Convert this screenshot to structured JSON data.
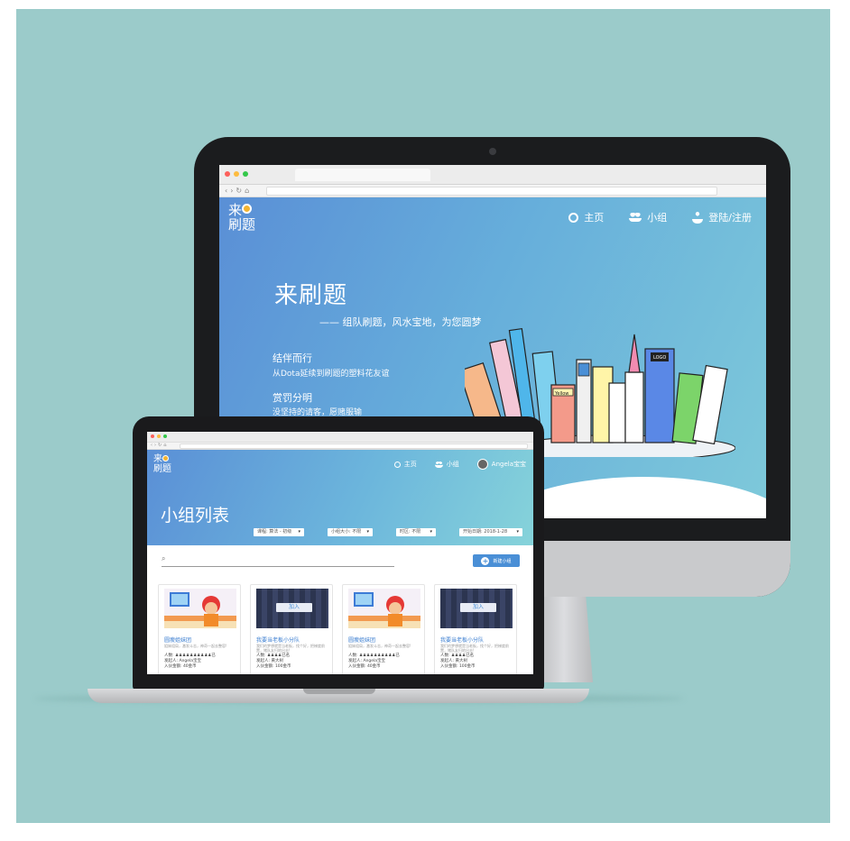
{
  "desktop": {
    "browser": {
      "tab": "",
      "url": ""
    },
    "logo": {
      "line1": "来",
      "line2": "刷题"
    },
    "nav": {
      "home": "主页",
      "groups": "小组",
      "login": "登陆/注册"
    },
    "hero": {
      "title": "来刷题",
      "slogan": "—— 组队刷题，风水宝地，为您圆梦",
      "features": [
        {
          "title": "结伴而行",
          "desc": "从Dota延续到刷题的塑料花友谊"
        },
        {
          "title": "赏罚分明",
          "desc": "没坚持的请客，愿赌服输"
        }
      ]
    },
    "city_signs": {
      "sign1": "Yellow",
      "sign2": "LOGO"
    }
  },
  "laptop": {
    "logo": {
      "line1": "来",
      "line2": "刷题"
    },
    "nav": {
      "home": "主页",
      "groups": "小组",
      "user": "Angela宝宝"
    },
    "page_title": "小组列表",
    "filters": [
      {
        "label": "课程: 算法 - 初级",
        "caret": "▾"
      },
      {
        "label": "小组大小: 不限",
        "caret": "▾"
      },
      {
        "label": "时区: 不限",
        "caret": "▾"
      },
      {
        "label": "开始日期: 2018-1-28",
        "caret": "▾"
      }
    ],
    "search": {
      "icon": "search-icon"
    },
    "create_button": "新建小组",
    "cards": [
      {
        "title": "圆瘦姐妹团",
        "desc": "姐妹组局，激发斗志，神奇一起去整容!",
        "meta1": "人数: ♟♟♟♟♟♟♟♟♟♟已",
        "meta2": "发起人: Angela宝宝",
        "meta3": "入伙金额: 40金币",
        "image": "a",
        "join": ""
      },
      {
        "title": "我要当老板小分队",
        "desc": "我们的梦想就是当老板，找个好，把梯度前置，猪队友扫地出去!",
        "meta1": "人数: ♟♟♟♟已名",
        "meta2": "发起人: 黄大树",
        "meta3": "入伙金额: 100金币",
        "image": "b",
        "join": "加入"
      },
      {
        "title": "圆瘦姐妹团",
        "desc": "姐妹组局，激发斗志，神奇一起去整容!",
        "meta1": "人数: ♟♟♟♟♟♟♟♟♟♟已",
        "meta2": "发起人: Angela宝宝",
        "meta3": "入伙金额: 40金币",
        "image": "a",
        "join": ""
      },
      {
        "title": "我要当老板小分队",
        "desc": "我们的梦想就是当老板，找个好，把梯度前置，猪队友扫地出去!",
        "meta1": "人数: ♟♟♟♟已名",
        "meta2": "发起人: 黄大树",
        "meta3": "入伙金额: 100金币",
        "image": "b",
        "join": "加入"
      }
    ]
  },
  "colors": {
    "background": "#9bcbca",
    "hero_start": "#5a8fd6",
    "hero_end": "#7ec9da",
    "accent": "#4a8fd6"
  }
}
